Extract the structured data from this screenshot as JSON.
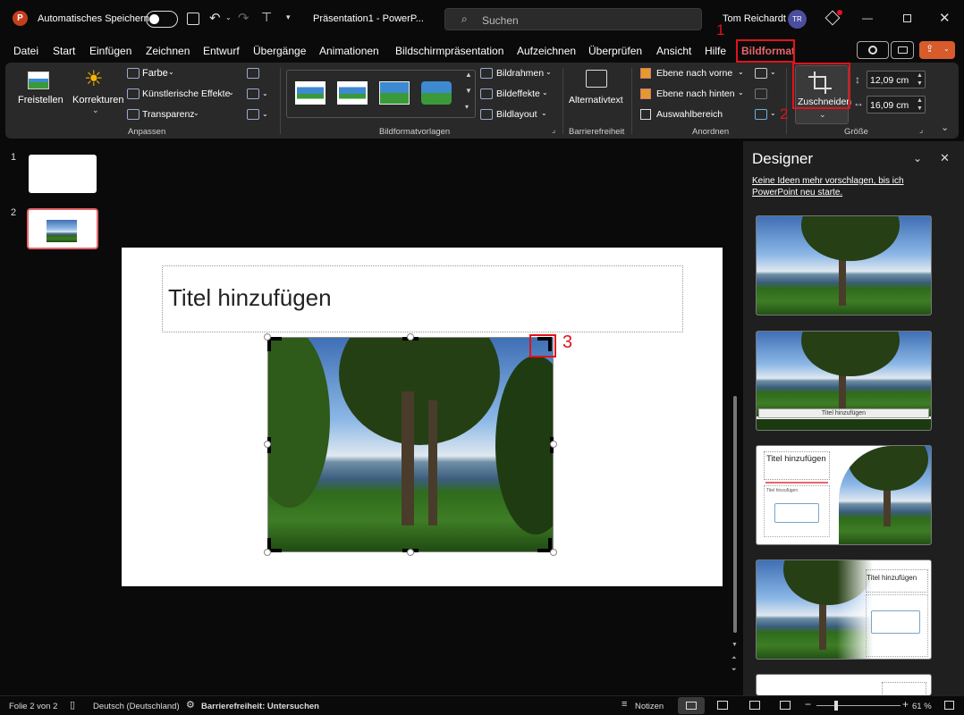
{
  "titlebar": {
    "autosave": "Automatisches Speichern",
    "document": "Präsentation1 - PowerP...",
    "search_placeholder": "Suchen",
    "user": "Tom Reichardt",
    "initials": "TR"
  },
  "menu": [
    "Datei",
    "Start",
    "Einfügen",
    "Zeichnen",
    "Entwurf",
    "Übergänge",
    "Animationen",
    "Bildschirmpräsentation",
    "Aufzeichnen",
    "Überprüfen",
    "Ansicht",
    "Hilfe",
    "Bildformat"
  ],
  "ribbon": {
    "freistellen": "Freistellen",
    "korrekturen": "Korrekturen",
    "farbe": "Farbe",
    "kuenstlerisch": "Künstlerische Effekte",
    "transparenz": "Transparenz",
    "group_anpassen": "Anpassen",
    "group_vorlagen": "Bildformatvorlagen",
    "bildrahmen": "Bildrahmen",
    "bildeffekte": "Bildeffekte",
    "bildlayout": "Bildlayout",
    "alternativtext": "Alternativtext",
    "group_barriere": "Barrierefreiheit",
    "ebene_vorne": "Ebene nach vorne",
    "ebene_hinten": "Ebene nach hinten",
    "auswahlbereich": "Auswahlbereich",
    "group_anordnen": "Anordnen",
    "zuschneiden": "Zuschneiden",
    "height": "12,09 cm",
    "width": "16,09 cm",
    "group_groesse": "Größe"
  },
  "annotations": {
    "a1": "1",
    "a2": "2",
    "a3": "3"
  },
  "slides": [
    "1",
    "2"
  ],
  "slide": {
    "title_placeholder": "Titel hinzufügen"
  },
  "designer": {
    "title": "Designer",
    "message": "Keine Ideen mehr vorschlagen, bis ich PowerPoint neu starte.",
    "mini_title": "Titel hinzufügen",
    "mini_title_split": "Titel hinzufügen",
    "mini_small": "Titel hinzufügen"
  },
  "status": {
    "slide_info": "Folie 2 von 2",
    "language": "Deutsch (Deutschland)",
    "accessibility": "Barrierefreiheit: Untersuchen",
    "notes": "Notizen",
    "zoom": "61 %"
  },
  "colors": {
    "accent": "#e8656b",
    "annotation": "#e0131a"
  }
}
